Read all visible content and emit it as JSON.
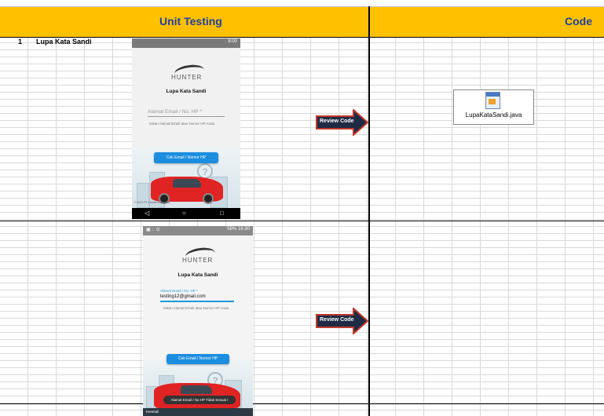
{
  "header": {
    "unit_testing": "Unit Testing",
    "code": "Code"
  },
  "rows": [
    {
      "number": "1",
      "label": "Lupa Kata Sandi"
    }
  ],
  "phone1": {
    "status_time": "8:00",
    "logo_text": "HUNTER",
    "title": "Lupa Kata Sandi",
    "field_placeholder": "Alamat Email / No. HP *",
    "hint": "Isikan Alamat Email atau Nomor HP Anda.",
    "button": "Cek Email / Nomor HP",
    "footnote": "© 2017 PT. Hunter Indonesia"
  },
  "phone2": {
    "status_time": "16:30",
    "status_battery": "58%",
    "logo_text": "HUNTER",
    "title": "Lupa Kata Sandi",
    "field_label": "Alamat Email / No. HP *",
    "field_value": "testing12@gmail.com",
    "hint": "Isikan Alamat Email atau Nomor HP Anda.",
    "button": "Cek Email / Nomor HP",
    "toast": "Alamat Email / No HP Tidak Sesuai !",
    "back": "Kembali"
  },
  "review_button_label": "Review Code",
  "code_file": {
    "name": "LupaKataSandi.java"
  },
  "colors": {
    "header_bg": "#ffc000",
    "header_text": "#1f3fa0",
    "arrow_fill": "#1f2a44",
    "arrow_border": "#c0392b",
    "app_button": "#1b8ee0",
    "car": "#e02323"
  }
}
